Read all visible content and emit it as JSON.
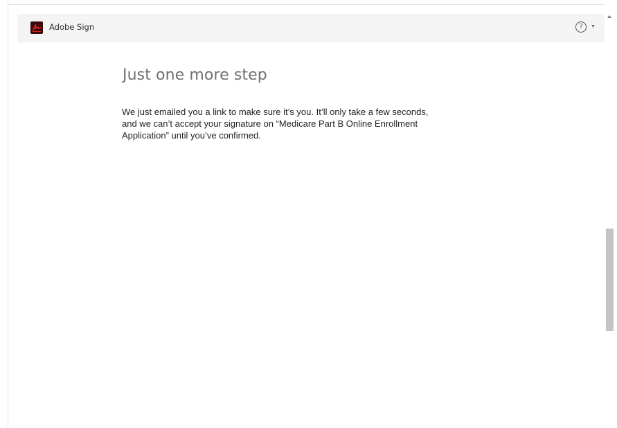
{
  "header": {
    "app_name": "Adobe Sign",
    "logo_icon": "adobe-sign-logo-icon",
    "help_icon": "question-mark-circle-icon",
    "help_caret_icon": "caret-down-icon",
    "help_symbol": "?",
    "caret_symbol": "▼"
  },
  "main": {
    "title": "Just one more step",
    "message_lines": [
      "We just emailed you a link to make sure it’s you. It’ll only take a few seconds,",
      "and we can’t accept your signature on “Medicare Part B Online Enrollment",
      "Application” until you’ve confirmed."
    ]
  },
  "colors": {
    "header_bg": "#f4f4f4",
    "logo_bg": "#3a0a0a",
    "logo_accent": "#e0261b",
    "title": "#707070",
    "body_text": "#222222"
  }
}
